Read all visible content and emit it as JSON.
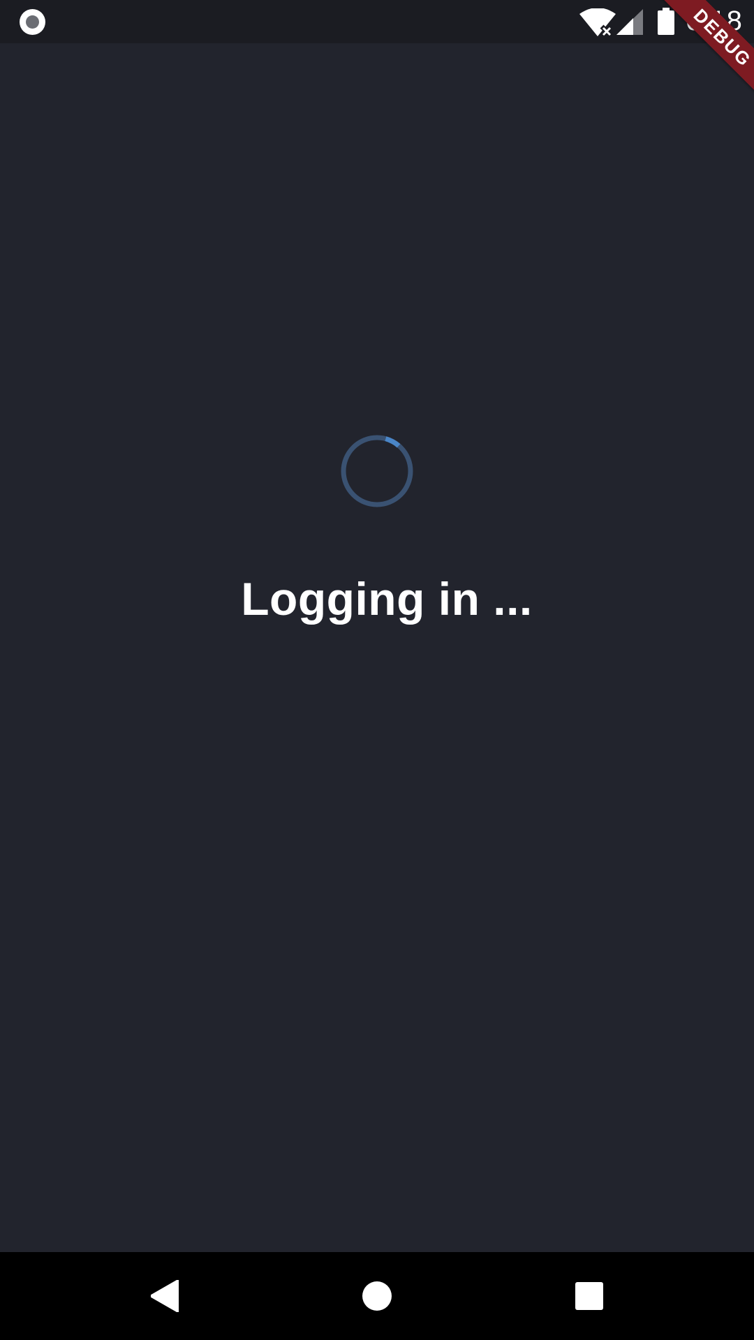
{
  "status_bar": {
    "time": "6:18",
    "icons": [
      "record-icon",
      "wifi-no-internet-icon",
      "cell-signal-icon",
      "battery-icon"
    ]
  },
  "debug_banner": {
    "label": "DEBUG",
    "color": "#7e1b22"
  },
  "main": {
    "loading_text": "Logging in ...",
    "spinner": {
      "track_color": "#3a5272",
      "arc_color": "#4a86c8"
    },
    "background_color": "#22242d"
  },
  "nav_bar": {
    "buttons": [
      "back-icon",
      "home-icon",
      "recents-icon"
    ]
  }
}
